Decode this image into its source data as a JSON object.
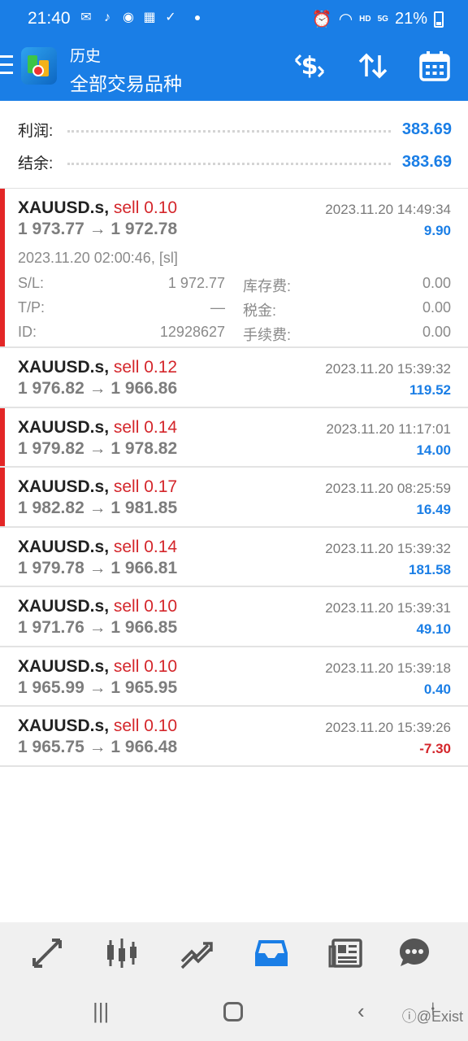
{
  "status_bar": {
    "time": "21:40",
    "hd_label": "HD",
    "network_label": "5G",
    "battery": "21%"
  },
  "app_bar": {
    "subtitle": "历史",
    "title": "全部交易品种",
    "icons": [
      "menu-icon",
      "app-logo",
      "dollar-sort-icon",
      "sort-arrows-icon",
      "calendar-icon"
    ]
  },
  "summary": {
    "profit_label": "利润:",
    "profit_value": "383.69",
    "balance_label": "结余:",
    "balance_value": "383.69"
  },
  "deals": [
    {
      "symbol": "XAUUSD.s,",
      "side": "sell 0.10",
      "time": "2023.11.20 14:49:34",
      "prices": "1 973.77 → 1 972.78",
      "profit": "9.90",
      "open_line": "2023.11.20 02:00:46, [sl]",
      "sl_label": "S/L:",
      "sl_value": "1 972.77",
      "tp_label": "T/P:",
      "tp_value": "—",
      "id_label": "ID:",
      "id_value": "12928627",
      "swap_label": "库存费:",
      "swap_value": "0.00",
      "tax_label": "税金:",
      "tax_value": "0.00",
      "fee_label": "手续费:",
      "fee_value": "0.00"
    },
    {
      "symbol": "XAUUSD.s,",
      "side": "sell 0.12",
      "time": "2023.11.20 15:39:32",
      "prices": "1 976.82 → 1 966.86",
      "profit": "119.52"
    },
    {
      "symbol": "XAUUSD.s,",
      "side": "sell 0.14",
      "time": "2023.11.20 11:17:01",
      "prices": "1 979.82 → 1 978.82",
      "profit": "14.00"
    },
    {
      "symbol": "XAUUSD.s,",
      "side": "sell 0.17",
      "time": "2023.11.20 08:25:59",
      "prices": "1 982.82 → 1 981.85",
      "profit": "16.49"
    },
    {
      "symbol": "XAUUSD.s,",
      "side": "sell 0.14",
      "time": "2023.11.20 15:39:32",
      "prices": "1 979.78 → 1 966.81",
      "profit": "181.58"
    },
    {
      "symbol": "XAUUSD.s,",
      "side": "sell 0.10",
      "time": "2023.11.20 15:39:31",
      "prices": "1 971.76 → 1 966.85",
      "profit": "49.10"
    },
    {
      "symbol": "XAUUSD.s,",
      "side": "sell 0.10",
      "time": "2023.11.20 15:39:18",
      "prices": "1 965.99 → 1 965.95",
      "profit": "0.40"
    },
    {
      "symbol": "XAUUSD.s,",
      "side": "sell 0.10",
      "time": "2023.11.20 15:39:26",
      "prices": "1 965.75 → 1 966.48",
      "profit": "-7.30"
    }
  ],
  "bottom_nav": {
    "items": [
      "quotes-icon",
      "chart-icon",
      "trade-icon",
      "history-icon",
      "news-icon",
      "chat-icon"
    ],
    "active": "history-icon",
    "active_color": "#1a7ee6"
  },
  "watermark": "ⓘ@Exist",
  "colors": {
    "header_blue": "#1a7ee6",
    "sell_red": "#d4262b",
    "profit_blue": "#1a7ee6"
  }
}
